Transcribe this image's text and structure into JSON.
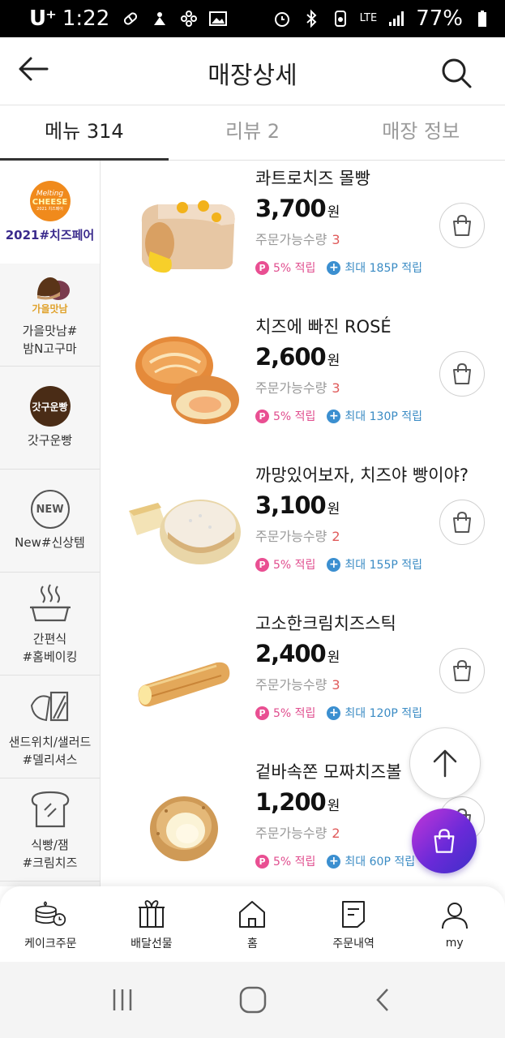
{
  "status_bar": {
    "carrier": "U⁺",
    "time": "1:22",
    "network": "LTE",
    "battery": "77%"
  },
  "header": {
    "title": "매장상세",
    "back_icon": "arrow-left-icon",
    "search_icon": "search-icon"
  },
  "tabs": [
    {
      "label": "메뉴 314",
      "active": true
    },
    {
      "label": "리뷰 2",
      "active": false
    },
    {
      "label": "매장 정보",
      "active": false
    }
  ],
  "sidebar": {
    "categories": [
      {
        "label": "2021#치즈페어",
        "icon": "melting-cheese-logo",
        "logo_text_1": "Melting",
        "logo_text_2": "CHEESE",
        "logo_text_3": "2021 치즈페어",
        "active": true
      },
      {
        "label": "가을맛남#\n밤N고구마",
        "icon": "chestnut-sweet-potato-icon",
        "icon_text": "가을맛남",
        "active": false
      },
      {
        "label": "갓구운빵",
        "icon": "fresh-baked-badge-icon",
        "icon_text": "갓구운빵",
        "active": false
      },
      {
        "label": "New#신상템",
        "icon": "new-badge-icon",
        "icon_text": "NEW",
        "active": false
      },
      {
        "label": "간편식\n#홈베이킹",
        "icon": "steaming-pot-icon",
        "active": false
      },
      {
        "label": "샌드위치/샐러드\n#델리셔스",
        "icon": "sandwich-icon",
        "active": false
      },
      {
        "label": "식빵/잼\n#크림치즈",
        "icon": "bread-loaf-icon",
        "active": false
      }
    ]
  },
  "products": [
    {
      "name": "콰트로치즈 몰빵",
      "price": "3,700",
      "currency": "원",
      "avail_label": "주문가능수량",
      "avail_qty": "3",
      "point_badge": "P",
      "point_rate": "5% 적립",
      "max_point": "최대 185P 적립"
    },
    {
      "name": "치즈에 빠진 ROSÉ",
      "price": "2,600",
      "currency": "원",
      "avail_label": "주문가능수량",
      "avail_qty": "3",
      "point_badge": "P",
      "point_rate": "5% 적립",
      "max_point": "최대 130P 적립"
    },
    {
      "name": "까망있어보자, 치즈야 빵이야?",
      "price": "3,100",
      "currency": "원",
      "avail_label": "주문가능수량",
      "avail_qty": "2",
      "point_badge": "P",
      "point_rate": "5% 적립",
      "max_point": "최대 155P 적립"
    },
    {
      "name": "고소한크림치즈스틱",
      "price": "2,400",
      "currency": "원",
      "avail_label": "주문가능수량",
      "avail_qty": "3",
      "point_badge": "P",
      "point_rate": "5% 적립",
      "max_point": "최대 120P 적립"
    },
    {
      "name": "겉바속쫀 모짜치즈볼",
      "price": "1,200",
      "currency": "원",
      "avail_label": "주문가능수량",
      "avail_qty": "2",
      "point_badge": "P",
      "point_rate": "5% 적립",
      "max_point": "최대 60P 적립"
    }
  ],
  "floating": {
    "scroll_top_icon": "arrow-up-icon",
    "cart_icon": "shopping-bag-icon"
  },
  "bottom_nav": [
    {
      "label": "케이크주문",
      "icon": "cake-clock-icon"
    },
    {
      "label": "배달선물",
      "icon": "gift-box-icon"
    },
    {
      "label": "홈",
      "icon": "home-icon"
    },
    {
      "label": "주문내역",
      "icon": "order-list-icon"
    },
    {
      "label": "my",
      "icon": "person-icon"
    }
  ],
  "colors": {
    "accent_purple": "#3a2a8c",
    "point_pink": "#e94f92",
    "point_blue": "#3b8fd0",
    "qty_red": "#e05a5a"
  }
}
